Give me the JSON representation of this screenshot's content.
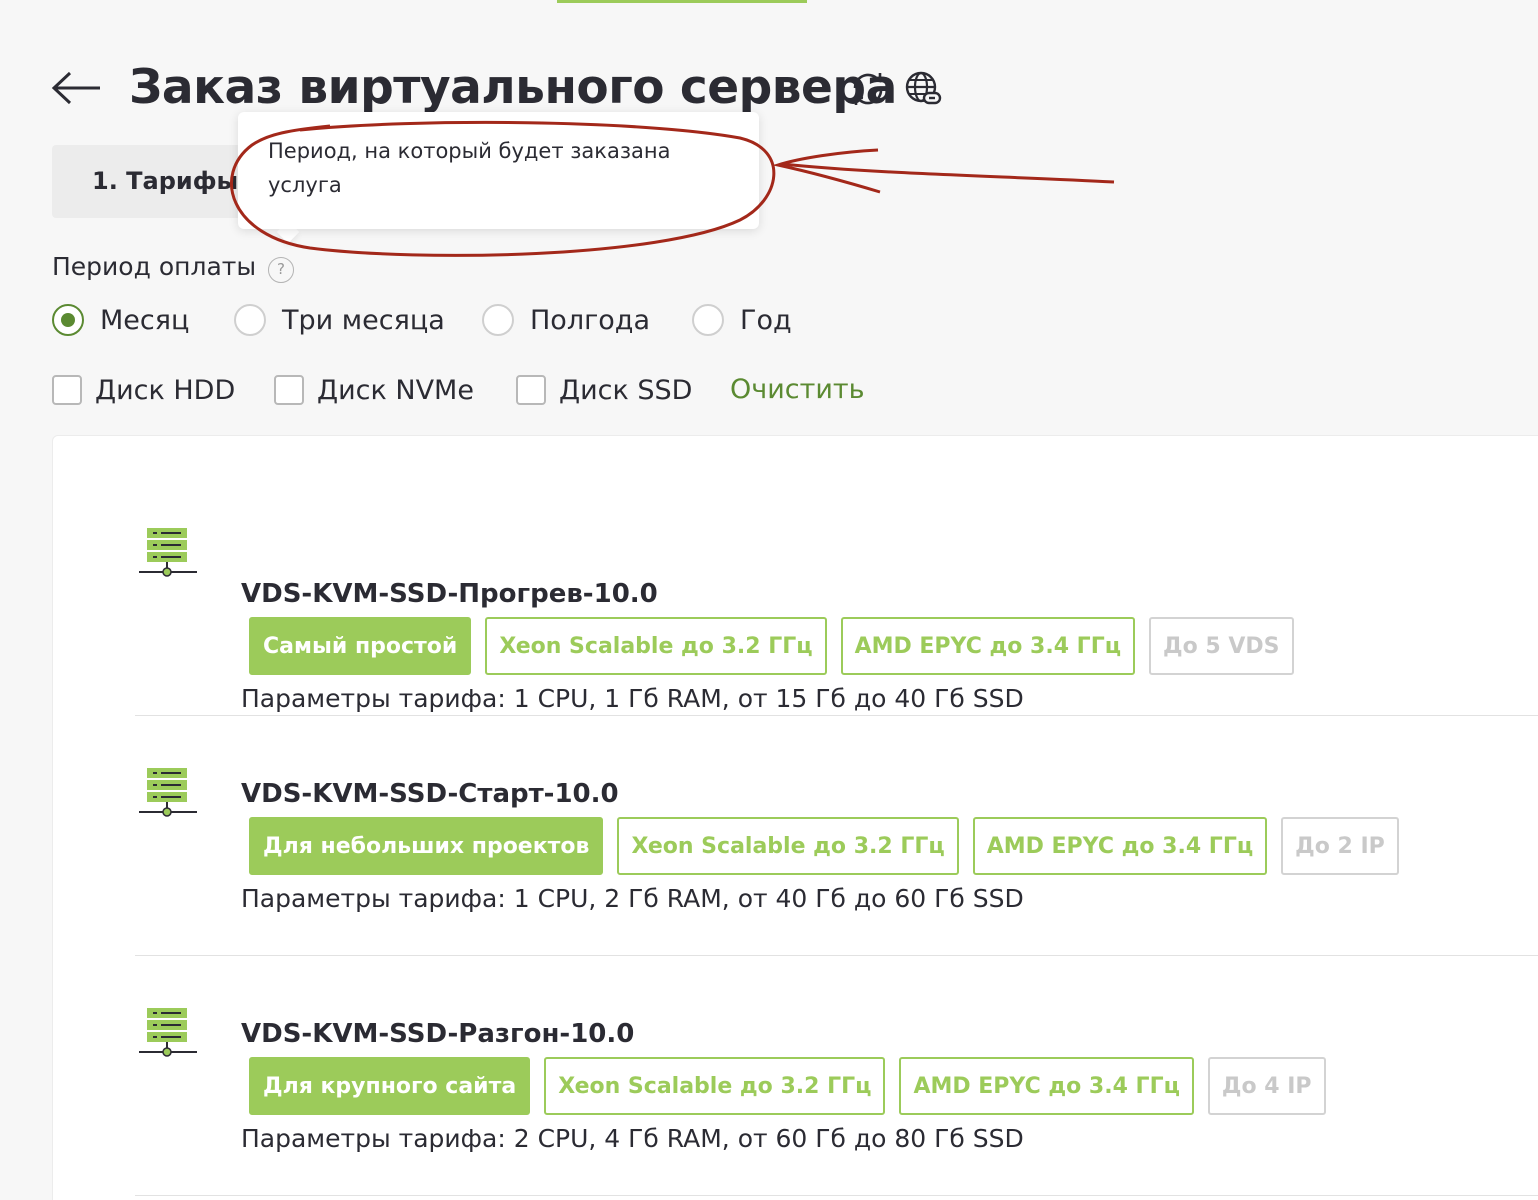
{
  "header": {
    "title": "Заказ виртуального сервера",
    "back_icon": "arrow-left-icon",
    "refresh_icon": "refresh-icon",
    "globe_icon": "globe-link-icon"
  },
  "steps": {
    "current_label": "1. Тарифы"
  },
  "tooltip": {
    "text": "Период, на который будет заказана услуга"
  },
  "period": {
    "label": "Период оплаты",
    "help_symbol": "?",
    "options": [
      {
        "label": "Месяц",
        "checked": true
      },
      {
        "label": "Три месяца",
        "checked": false
      },
      {
        "label": "Полгода",
        "checked": false
      },
      {
        "label": "Год",
        "checked": false
      }
    ]
  },
  "filters": {
    "disks": [
      {
        "label": "Диск HDD",
        "checked": false
      },
      {
        "label": "Диск NVMe",
        "checked": false
      },
      {
        "label": "Диск SSD",
        "checked": false
      }
    ],
    "clear_label": "Очистить"
  },
  "tariffs": [
    {
      "name": "VDS-KVM-SSD-Прогрев-10.0",
      "badges": [
        "Самый простой",
        "Xeon Scalable до 3.2 ГГц",
        "AMD EPYC до 3.4 ГГц",
        "До 5 VDS"
      ],
      "params": "Параметры тарифа: 1 CPU, 1 Гб RAM, от 15 Гб до 40 Гб SSD"
    },
    {
      "name": "VDS-KVM-SSD-Старт-10.0",
      "badges": [
        "Для небольших проектов",
        "Xeon Scalable до 3.2 ГГц",
        "AMD EPYC до 3.4 ГГц",
        "До 2 IP"
      ],
      "params": "Параметры тарифа: 1 CPU, 2 Гб RAM, от 40 Гб до 60 Гб SSD"
    },
    {
      "name": "VDS-KVM-SSD-Разгон-10.0",
      "badges": [
        "Для крупного сайта",
        "Xeon Scalable до 3.2 ГГц",
        "AMD EPYC до 3.4 ГГц",
        "До 4 IP"
      ],
      "params": "Параметры тарифа: 2 CPU, 4 Гб RAM, от 60 Гб до 80 Гб SSD"
    }
  ],
  "colors": {
    "accent_green": "#9ccb5a",
    "dark_green": "#5b8a32",
    "annotation_red": "#a3281a"
  }
}
